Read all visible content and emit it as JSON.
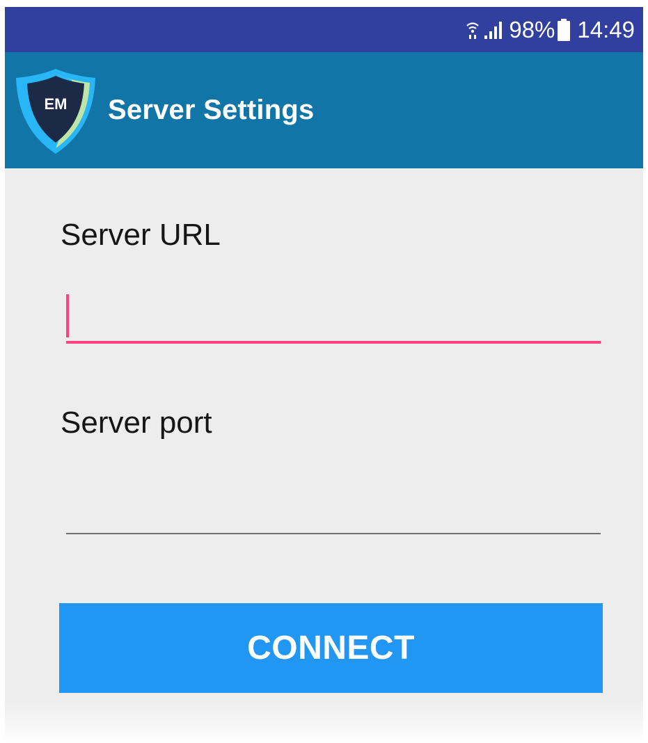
{
  "status_bar": {
    "battery": "98%",
    "time": "14:49",
    "icons": [
      "wifi-icon",
      "signal-icon",
      "battery-icon"
    ]
  },
  "app_bar": {
    "logo_text": "EM",
    "title": "Server Settings"
  },
  "form": {
    "url_label": "Server URL",
    "url_value": "",
    "url_focused": true,
    "port_label": "Server port",
    "port_value": ""
  },
  "actions": {
    "connect_label": "CONNECT"
  },
  "colors": {
    "status_bar": "#313f9f",
    "app_bar": "#1175a8",
    "background": "#ecedec",
    "accent": "#ff4081",
    "button": "#2196f3"
  }
}
